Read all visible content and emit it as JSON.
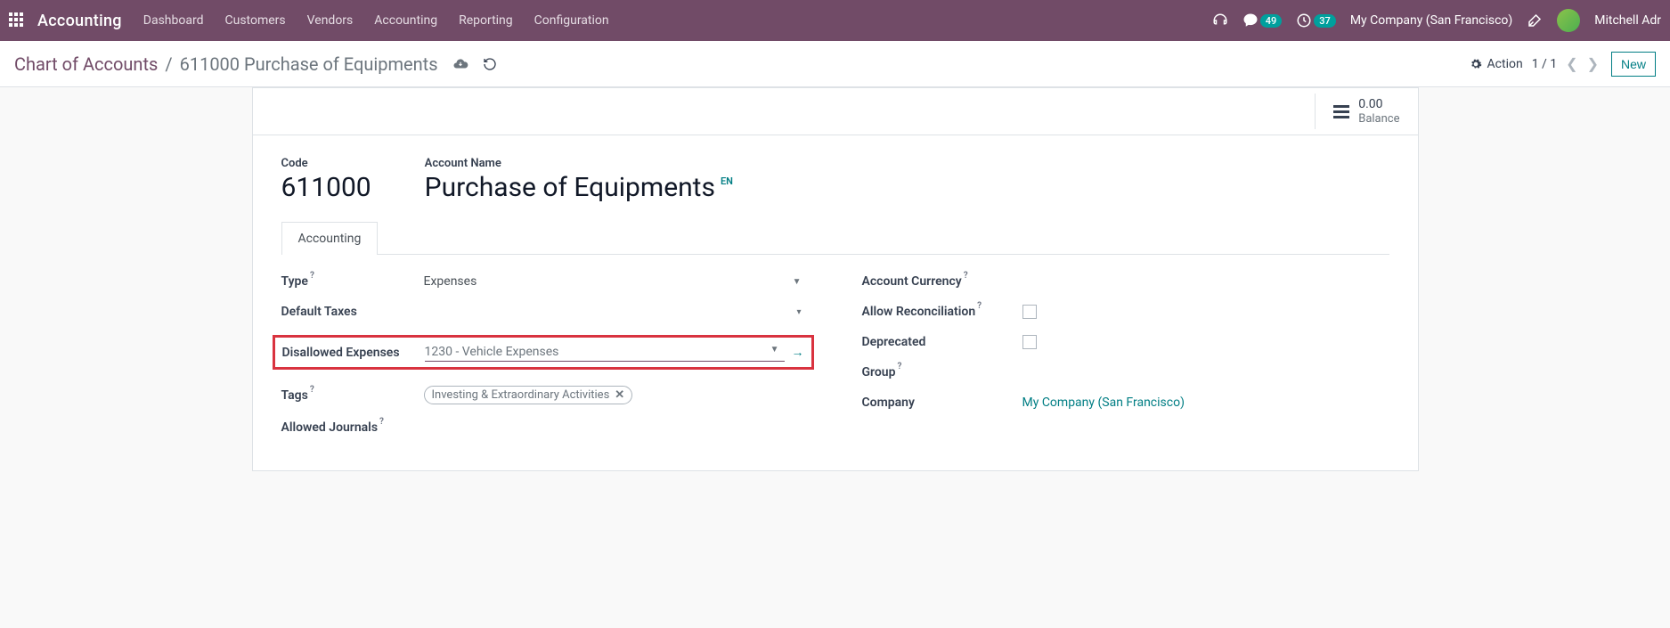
{
  "topbar": {
    "app_name": "Accounting",
    "nav": [
      "Dashboard",
      "Customers",
      "Vendors",
      "Accounting",
      "Reporting",
      "Configuration"
    ],
    "messages_badge": "49",
    "activities_badge": "37",
    "company": "My Company (San Francisco)",
    "user": "Mitchell Adr"
  },
  "crumb": {
    "root": "Chart of Accounts",
    "current": "611000 Purchase of Equipments",
    "action_label": "Action",
    "pager": "1 / 1",
    "new_label": "New"
  },
  "stat": {
    "value": "0.00",
    "label": "Balance"
  },
  "header": {
    "code_label": "Code",
    "code_value": "611000",
    "name_label": "Account Name",
    "name_value": "Purchase of Equipments",
    "lang": "EN"
  },
  "tabs": {
    "accounting": "Accounting"
  },
  "fields": {
    "type_label": "Type",
    "type_value": "Expenses",
    "default_taxes_label": "Default Taxes",
    "disallowed_label": "Disallowed Expenses",
    "disallowed_value": "1230 - Vehicle Expenses",
    "tags_label": "Tags",
    "tag_value": "Investing & Extraordinary Activities",
    "allowed_journals_label": "Allowed Journals",
    "currency_label": "Account Currency",
    "allow_recon_label": "Allow Reconciliation",
    "deprecated_label": "Deprecated",
    "group_label": "Group",
    "company_label": "Company",
    "company_value": "My Company (San Francisco)"
  }
}
